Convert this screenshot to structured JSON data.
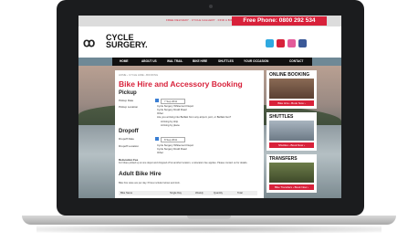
{
  "site": {
    "top_links": "FREE DELIVERY  ·  CYCLE GALLERY  ·  FIND A BIKE",
    "phone": "Free Phone: 0800 292 534",
    "logo_line1": "CYCLE",
    "logo_line2": "SURGERY.",
    "social": [
      {
        "icon": "twitter-icon",
        "color": "#2fa9e0"
      },
      {
        "icon": "youtube-icon",
        "color": "#d8213a"
      },
      {
        "icon": "flickr-icon",
        "color": "#e35b9a"
      },
      {
        "icon": "facebook-icon",
        "color": "#3b5998"
      }
    ]
  },
  "nav": [
    "HOME",
    "ABOUT US",
    "WAL TRAIL",
    "BIKE HIRE",
    "SHUTTLES",
    "YOUR OCCASION",
    "CONTACT"
  ],
  "content": {
    "breadcrumb": "HOME › CYCLE HIRE › BOOKING",
    "title": "Bike Hire and Accessory Booking",
    "pickup": {
      "heading": "Pickup",
      "date_label": "Pickup Date",
      "date_value": "7 Sep 2011",
      "location_label": "Pickup Location",
      "options": [
        "Cycle Surgery Whitecourt Depot",
        "Cycle Surgery Rodd Road",
        "Other"
      ],
      "question": "Are you arriving into Belfast from any airport, port, or Belfast bus?",
      "sub_options": [
        "Arriving by ship",
        "Arriving by plane"
      ]
    },
    "dropoff": {
      "heading": "Dropoff",
      "date_label": "Dropoff Date",
      "date_value": "8 Sep 2011",
      "location_label": "Dropoff Location",
      "options": [
        "Cycle Surgery Whitecourt Depot",
        "Cycle Surgery Rodd Road",
        "Other"
      ]
    },
    "relocation": {
      "heading": "Relocation Fee",
      "text": "For bikes picked up at one depot and dropped off at another location, a relocation fee applies. Please contact us for details."
    },
    "adult": {
      "heading": "Adult Bike Hire",
      "text": "Bike hire rates are per day. Prices include helmet and lock.",
      "columns": [
        "Bike Name",
        "Single Day",
        "Weekly",
        "Quantity",
        "Total"
      ]
    }
  },
  "sidebar": [
    {
      "title": "ONLINE BOOKING",
      "button": "Bike Hire › Book Now ›",
      "img": "#7a5a4a"
    },
    {
      "title": "SHUTTLES",
      "button": "Shuttles › Book Now ›",
      "img": "#8e9aa6"
    },
    {
      "title": "TRANSFERS",
      "button": "Bike Transfers › Book Now ›",
      "img": "#5b6b3f"
    }
  ]
}
